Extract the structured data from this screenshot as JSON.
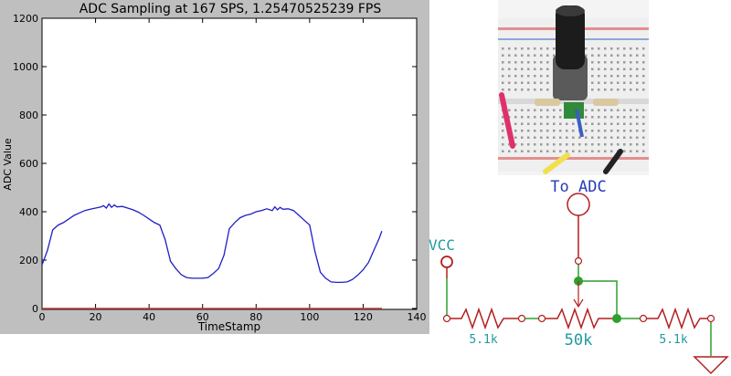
{
  "chart_data": {
    "type": "line",
    "title": "ADC Sampling at 167 SPS, 1.25470525239 FPS",
    "xlabel": "TimeStamp",
    "ylabel": "ADC Value",
    "xlim": [
      0,
      140
    ],
    "ylim": [
      0,
      1200
    ],
    "xticks": [
      "0",
      "20",
      "40",
      "60",
      "80",
      "100",
      "120",
      "140"
    ],
    "yticks": [
      "0",
      "200",
      "400",
      "600",
      "800",
      "1000",
      "1200"
    ],
    "grid": false,
    "series": [
      {
        "color": "#1f1fc8",
        "x": [
          0,
          2,
          4,
          6,
          8,
          10,
          12,
          14,
          16,
          18,
          20,
          22,
          23,
          24,
          25,
          26,
          27,
          28,
          30,
          32,
          34,
          36,
          38,
          40,
          42,
          44,
          46,
          48,
          50,
          52,
          54,
          56,
          58,
          60,
          62,
          64,
          66,
          68,
          70,
          72,
          74,
          76,
          78,
          80,
          82,
          84,
          86,
          87,
          88,
          89,
          90,
          92,
          94,
          96,
          98,
          100,
          102,
          104,
          106,
          108,
          110,
          112,
          114,
          116,
          118,
          120,
          122,
          124,
          126,
          127
        ],
        "y": [
          180,
          240,
          325,
          345,
          355,
          370,
          385,
          395,
          405,
          410,
          415,
          420,
          425,
          415,
          432,
          418,
          428,
          420,
          422,
          415,
          408,
          398,
          385,
          370,
          355,
          345,
          285,
          195,
          165,
          140,
          128,
          125,
          125,
          125,
          128,
          145,
          165,
          220,
          330,
          355,
          375,
          385,
          390,
          400,
          405,
          412,
          405,
          420,
          408,
          418,
          410,
          412,
          405,
          385,
          365,
          345,
          235,
          150,
          125,
          110,
          108,
          108,
          110,
          120,
          138,
          160,
          190,
          240,
          290,
          320
        ]
      }
    ]
  },
  "schematic": {
    "vcc_label": "VCC",
    "adc_label": "To ADC",
    "r1_label": "5.1k",
    "pot_label": "50k",
    "r2_label": "5.1k"
  },
  "colors": {
    "chart_panel": "#bfbfbf",
    "schematic_wire": "#2ea02e",
    "schematic_part": "#b41e1e",
    "schematic_text": "#2a3cb4",
    "schematic_label": "#1e9aa0"
  }
}
